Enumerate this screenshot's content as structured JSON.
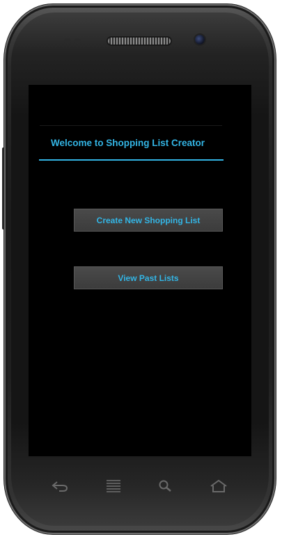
{
  "app": {
    "title": "Welcome to Shopping List Creator"
  },
  "buttons": {
    "create_label": "Create New Shopping List",
    "view_label": "View Past Lists"
  },
  "device_keys": [
    "back-icon",
    "menu-icon",
    "search-icon",
    "home-icon"
  ],
  "colors": {
    "accent": "#33b5e5",
    "screen_bg": "#000000",
    "button_bg": "#414141"
  }
}
